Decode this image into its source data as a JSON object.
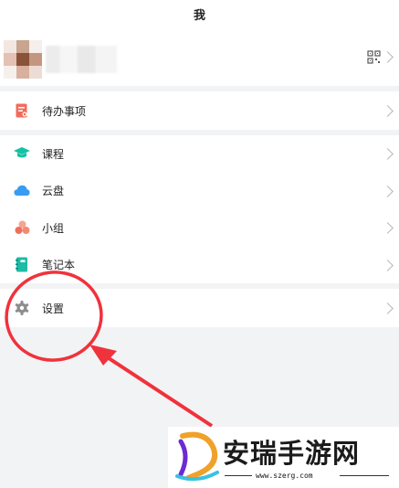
{
  "header": {
    "title": "我"
  },
  "profile": {
    "qr_icon": "qr-code-icon",
    "chevron_icon": "chevron-right-icon"
  },
  "menu_groups": [
    {
      "items": [
        {
          "label": "待办事项",
          "icon": "todo-icon",
          "color": "#f06b5c"
        }
      ]
    },
    {
      "items": [
        {
          "label": "课程",
          "icon": "graduation-cap-icon",
          "color": "#13c2a3"
        },
        {
          "label": "云盘",
          "icon": "cloud-icon",
          "color": "#3a9bf3"
        },
        {
          "label": "小组",
          "icon": "group-icon",
          "color": "#f28a72"
        },
        {
          "label": "笔记本",
          "icon": "notebook-icon",
          "color": "#1ebba5"
        }
      ]
    },
    {
      "items": [
        {
          "label": "设置",
          "icon": "gear-icon",
          "color": "#8d8d8d"
        }
      ]
    }
  ],
  "annotation": {
    "color": "#f0323c",
    "shape": "circle-with-arrow"
  },
  "watermark": {
    "title": "安瑞手游网",
    "url": "www.szerg.com"
  }
}
